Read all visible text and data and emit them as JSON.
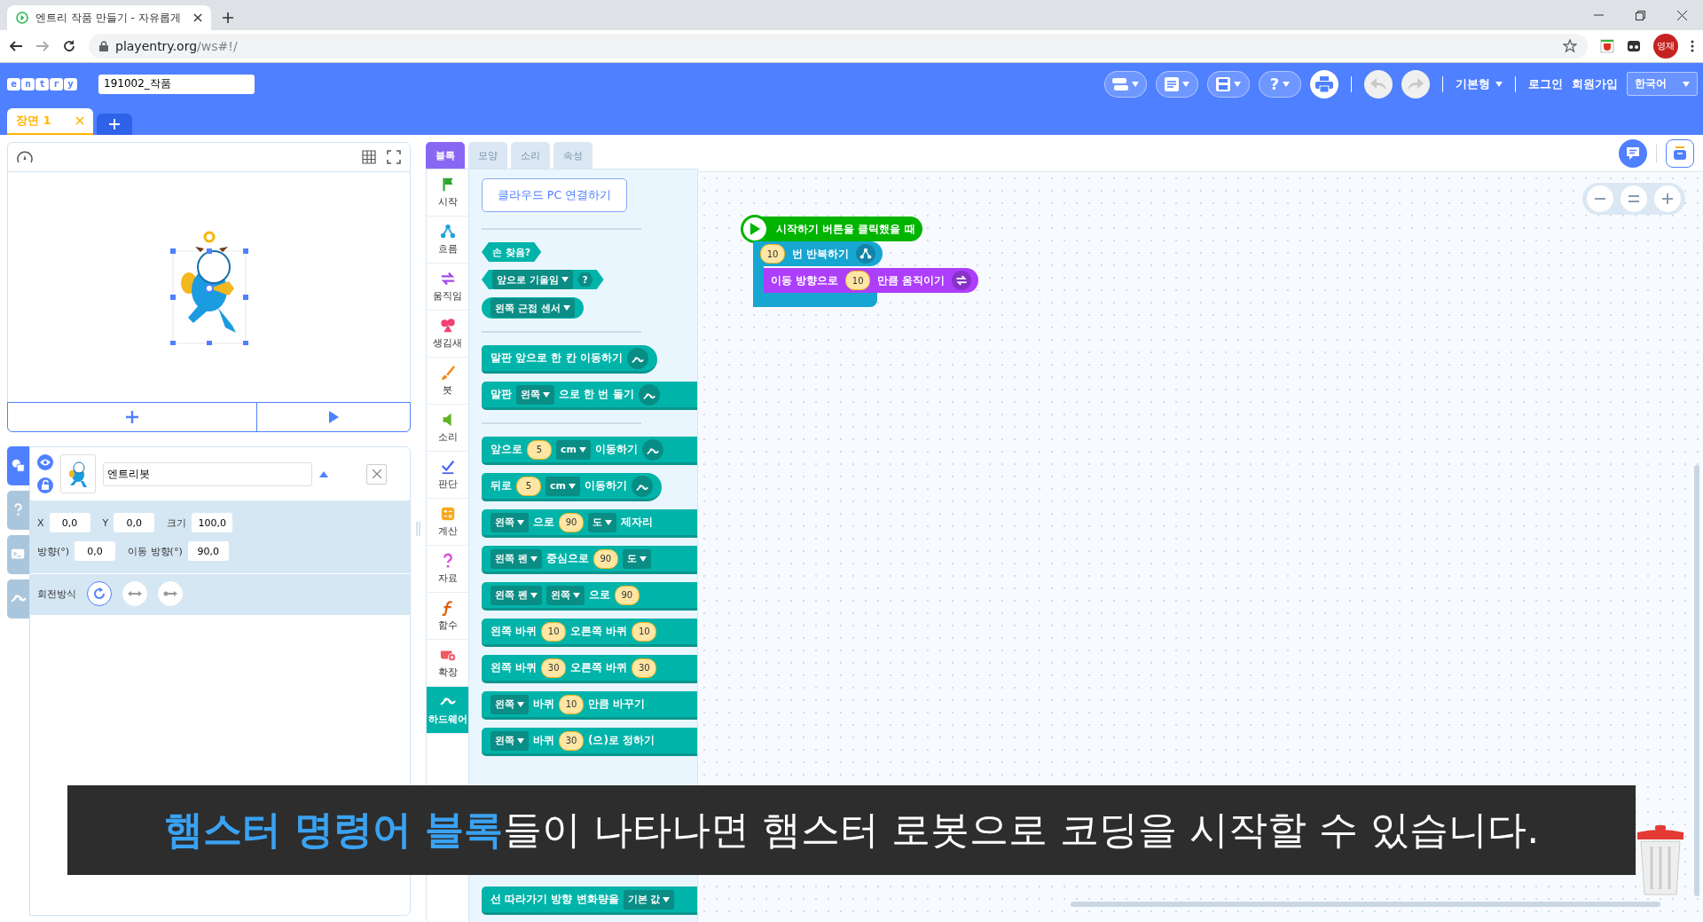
{
  "browser": {
    "tab_title": "엔트리 작품 만들기 - 자유롭게",
    "url_host": "playentry.org",
    "url_path": "/ws#!/",
    "profile": "영재"
  },
  "header": {
    "logo": [
      "e",
      "n",
      "t",
      "r",
      "y"
    ],
    "project_name": "191002_작품",
    "help_glyph": "?",
    "mode": "기본형",
    "login": "로그인",
    "signup": "회원가입",
    "language": "한국어"
  },
  "scenes": [
    {
      "label": "장면 1",
      "selected": true
    }
  ],
  "object": {
    "name": "엔트리봇",
    "side_tabs": [
      {
        "selected": true
      },
      {
        "selected": false
      },
      {
        "selected": false
      },
      {
        "selected": false
      }
    ],
    "fields": [
      {
        "label": "X",
        "value": "0,0"
      },
      {
        "label": "Y",
        "value": "0,0"
      },
      {
        "label": "크기",
        "value": "100,0"
      },
      {
        "label": "방향(°)",
        "value": "0,0"
      },
      {
        "label": "이동 방향(°)",
        "value": "90,0"
      }
    ],
    "rotation_label": "회전방식",
    "rotation_modes": [
      {
        "selected": true
      },
      {
        "selected": false
      },
      {
        "selected": false
      }
    ]
  },
  "palette": {
    "tabs": [
      {
        "label": "블록",
        "selected": true
      },
      {
        "label": "모양",
        "selected": false
      },
      {
        "label": "소리",
        "selected": false
      },
      {
        "label": "속성",
        "selected": false
      }
    ],
    "categories": [
      {
        "label": "시작",
        "color": "#2ea52e",
        "selected": false
      },
      {
        "label": "흐름",
        "color": "#1fa3d8",
        "selected": false
      },
      {
        "label": "움직임",
        "color": "#a24ee6",
        "selected": false
      },
      {
        "label": "생김새",
        "color": "#f2416f",
        "selected": false
      },
      {
        "label": "붓",
        "color": "#f58a1f",
        "selected": false
      },
      {
        "label": "소리",
        "color": "#5fb320",
        "selected": false
      },
      {
        "label": "판단",
        "color": "#4a60f0",
        "selected": false
      },
      {
        "label": "계산",
        "color": "#f7a81b",
        "selected": false
      },
      {
        "label": "자료",
        "color": "#d94fdc",
        "selected": false
      },
      {
        "label": "함수",
        "color": "#e0600b",
        "selected": false
      },
      {
        "label": "확장",
        "color": "#f05a64",
        "selected": false
      },
      {
        "label": "하드웨어",
        "color": "#00b4aa",
        "selected": true
      }
    ],
    "cloud_button": "클라우드 PC 연결하기",
    "blocks": [
      {
        "kind": "divider"
      },
      {
        "kind": "hex",
        "parts": [
          {
            "kind": "text",
            "text": "손 찾음?"
          }
        ]
      },
      {
        "kind": "hex",
        "parts": [
          {
            "kind": "dropdown",
            "text": "앞으로 기울임"
          },
          {
            "kind": "slot",
            "text": "?"
          }
        ]
      },
      {
        "kind": "round",
        "parts": [
          {
            "kind": "dropdown",
            "text": "왼쪽 근접 센서"
          }
        ]
      },
      {
        "kind": "divider"
      },
      {
        "kind": "stack",
        "cut": false,
        "icon": true,
        "parts": [
          {
            "kind": "text",
            "text": "말판 앞으로 한 칸 이동하기"
          }
        ]
      },
      {
        "kind": "stack",
        "cut": true,
        "icon": true,
        "parts": [
          {
            "kind": "text",
            "text": "말판"
          },
          {
            "kind": "dropdown",
            "text": "왼쪽"
          },
          {
            "kind": "text",
            "text": "으로 한 번 돌기"
          }
        ]
      },
      {
        "kind": "divider"
      },
      {
        "kind": "stack",
        "cut": true,
        "icon": true,
        "parts": [
          {
            "kind": "text",
            "text": "앞으로"
          },
          {
            "kind": "number",
            "text": "5"
          },
          {
            "kind": "dropdown",
            "text": "cm"
          },
          {
            "kind": "text",
            "text": "이동하기"
          }
        ]
      },
      {
        "kind": "stack",
        "cut": false,
        "icon": true,
        "parts": [
          {
            "kind": "text",
            "text": "뒤로"
          },
          {
            "kind": "number",
            "text": "5"
          },
          {
            "kind": "dropdown",
            "text": "cm"
          },
          {
            "kind": "text",
            "text": "이동하기"
          }
        ]
      },
      {
        "kind": "stack",
        "cut": true,
        "icon": false,
        "parts": [
          {
            "kind": "dropdown",
            "text": "왼쪽"
          },
          {
            "kind": "text",
            "text": "으로"
          },
          {
            "kind": "number",
            "text": "90"
          },
          {
            "kind": "dropdown",
            "text": "도"
          },
          {
            "kind": "text",
            "text": "제자리"
          }
        ]
      },
      {
        "kind": "stack",
        "cut": true,
        "icon": false,
        "parts": [
          {
            "kind": "dropdown",
            "text": "왼쪽 펜"
          },
          {
            "kind": "text",
            "text": "중심으로"
          },
          {
            "kind": "number",
            "text": "90"
          },
          {
            "kind": "dropdown",
            "text": "도"
          }
        ]
      },
      {
        "kind": "stack",
        "cut": true,
        "icon": false,
        "parts": [
          {
            "kind": "dropdown",
            "text": "왼쪽 펜"
          },
          {
            "kind": "dropdown",
            "text": "왼쪽"
          },
          {
            "kind": "text",
            "text": "으로"
          },
          {
            "kind": "number",
            "text": "90"
          }
        ]
      },
      {
        "kind": "stack",
        "cut": true,
        "icon": false,
        "parts": [
          {
            "kind": "text",
            "text": "왼쪽 바퀴"
          },
          {
            "kind": "number",
            "text": "10"
          },
          {
            "kind": "text",
            "text": "오른쪽 바퀴"
          },
          {
            "kind": "number",
            "text": "10"
          }
        ]
      },
      {
        "kind": "stack",
        "cut": true,
        "icon": false,
        "parts": [
          {
            "kind": "text",
            "text": "왼쪽 바퀴"
          },
          {
            "kind": "number",
            "text": "30"
          },
          {
            "kind": "text",
            "text": "오른쪽 바퀴"
          },
          {
            "kind": "number",
            "text": "30"
          }
        ]
      },
      {
        "kind": "stack",
        "cut": true,
        "icon": false,
        "parts": [
          {
            "kind": "dropdown",
            "text": "왼쪽"
          },
          {
            "kind": "text",
            "text": "바퀴"
          },
          {
            "kind": "number",
            "text": "10"
          },
          {
            "kind": "text",
            "text": "만큼 바꾸기"
          }
        ]
      },
      {
        "kind": "stack",
        "cut": true,
        "icon": false,
        "parts": [
          {
            "kind": "dropdown",
            "text": "왼쪽"
          },
          {
            "kind": "text",
            "text": "바퀴"
          },
          {
            "kind": "number",
            "text": "30"
          },
          {
            "kind": "text",
            "text": "(으)로 정하기"
          }
        ]
      },
      {
        "kind": "stack",
        "cut": true,
        "icon": false,
        "parts": [
          {
            "kind": "text",
            "text": "선 따라가기 방향 변화량을"
          },
          {
            "kind": "dropdown",
            "text": "기본 값"
          }
        ]
      }
    ]
  },
  "script": [
    {
      "kind": "hat",
      "color": "#00b400",
      "parts": [
        {
          "kind": "text",
          "text": "시작하기 버튼을 클릭했을 때"
        }
      ]
    },
    {
      "kind": "loop",
      "color": "#17a6d1",
      "parts": [
        {
          "kind": "number",
          "text": "10"
        },
        {
          "kind": "text",
          "text": "번 반복하기"
        }
      ],
      "children": [
        {
          "kind": "command",
          "color": "#ad3efc",
          "parts": [
            {
              "kind": "text",
              "text": "이동 방향으로"
            },
            {
              "kind": "number",
              "text": "10"
            },
            {
              "kind": "text",
              "text": "만큼 움직이기"
            }
          ]
        }
      ]
    }
  ],
  "caption": {
    "highlight": "햄스터 명령어 블록",
    "rest": "들이 나타나면 햄스터 로봇으로 코딩을 시작할 수 있습니다."
  }
}
